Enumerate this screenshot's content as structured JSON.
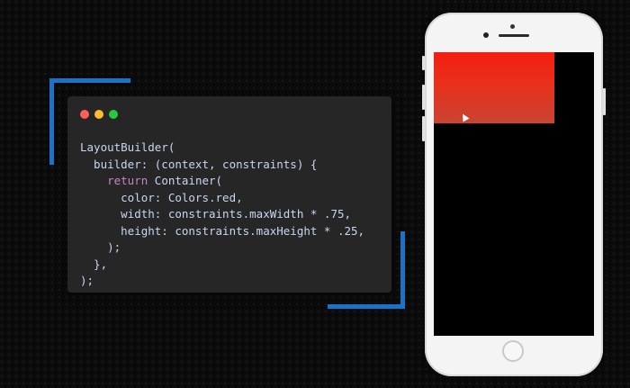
{
  "code_window": {
    "traffic_lights": [
      "close",
      "minimize",
      "maximize"
    ],
    "lines": [
      [
        {
          "t": "LayoutBuilder(",
          "c": "plain"
        }
      ],
      [
        {
          "t": "  builder: (context, constraints) {",
          "c": "plain"
        }
      ],
      [
        {
          "t": "    ",
          "c": "plain"
        },
        {
          "t": "return",
          "c": "kw"
        },
        {
          "t": " Container(",
          "c": "plain"
        }
      ],
      [
        {
          "t": "      color: Colors.red,",
          "c": "plain"
        }
      ],
      [
        {
          "t": "      width: constraints.maxWidth * .75,",
          "c": "plain"
        }
      ],
      [
        {
          "t": "      height: constraints.maxHeight * .25,",
          "c": "plain"
        }
      ],
      [
        {
          "t": "    );",
          "c": "plain"
        }
      ],
      [
        {
          "t": "  },",
          "c": "plain"
        }
      ],
      [
        {
          "t": ");",
          "c": "plain"
        }
      ]
    ]
  },
  "phone_preview": {
    "container_color": "#f51e10",
    "container_width_fraction": 0.75,
    "container_height_fraction": 0.25,
    "screen_background": "#000000"
  },
  "colors": {
    "accent_blue": "#1a73c8",
    "code_text": "#c8d6f0",
    "keyword": "#c586c0"
  }
}
